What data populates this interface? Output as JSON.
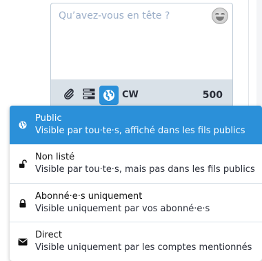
{
  "composer": {
    "placeholder": "Qu’avez-vous en tête ?",
    "character_count": "500",
    "cw_label": "CW"
  },
  "toolbar": {
    "icons": [
      "paperclip-icon",
      "poll-icon",
      "globe-icon"
    ]
  },
  "privacy_menu": {
    "options": [
      {
        "icon": "globe-icon",
        "title": "Public",
        "description": "Visible par tou·te·s, affiché dans les fils publics",
        "selected": true
      },
      {
        "icon": "unlock-icon",
        "title": "Non listé",
        "description": "Visible par tou·te·s, mais pas dans les fils publics",
        "selected": false
      },
      {
        "icon": "lock-icon",
        "title": "Abonné·e·s uniquement",
        "description": "Visible uniquement par vos abonné·e·s",
        "selected": false
      },
      {
        "icon": "envelope-icon",
        "title": "Direct",
        "description": "Visible uniquement par les comptes mentionnés",
        "selected": false
      }
    ]
  },
  "colors": {
    "accent": "#2b90d9",
    "toolbar_bg": "#d9e1e8",
    "placeholder": "#9baec8",
    "text": "#282c37"
  }
}
